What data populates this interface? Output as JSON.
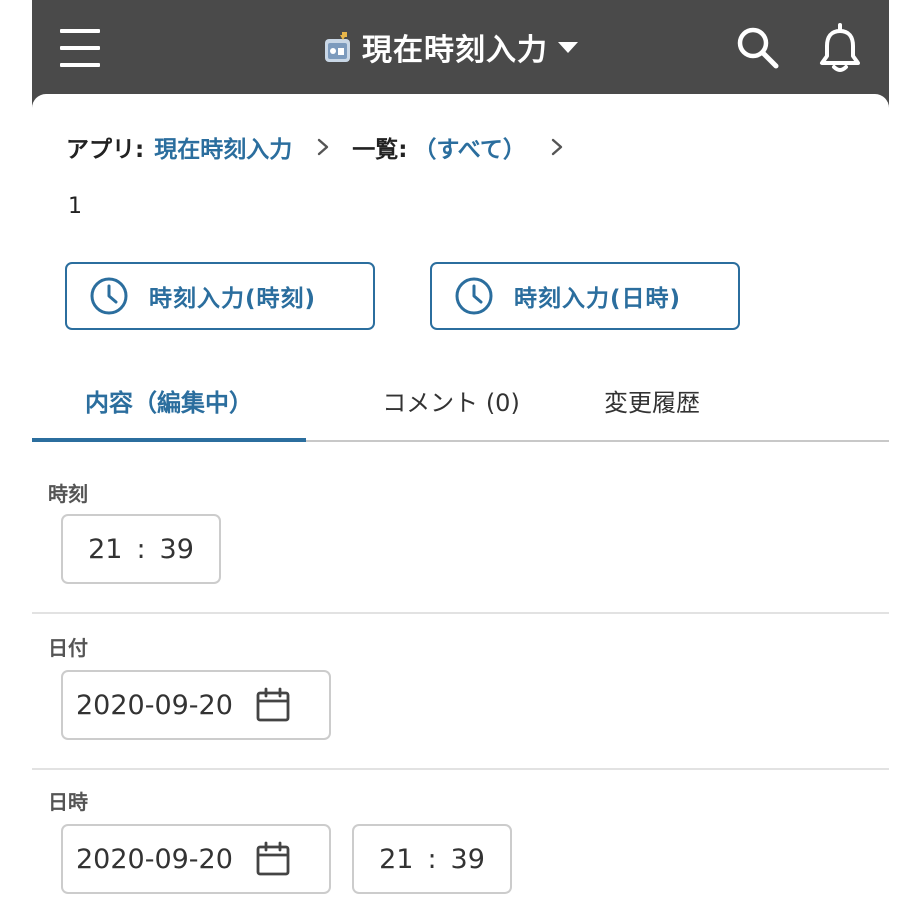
{
  "header": {
    "app_title": "現在時刻入力",
    "menu_icon": "hamburger-icon",
    "search_icon": "search-icon",
    "notification_icon": "bell-icon",
    "background_color": "#4a4a4a"
  },
  "breadcrumb": {
    "app_label": "アプリ:",
    "app_name": "現在時刻入力",
    "list_label": "一覧:",
    "list_name": "（すべて）"
  },
  "record": {
    "id": "1"
  },
  "actions": {
    "time_button_label": "時刻入力(時刻)",
    "datetime_button_label": "時刻入力(日時)",
    "accent_color": "#2b6e9e"
  },
  "tabs": [
    {
      "label": "内容（編集中）",
      "active": true
    },
    {
      "label": "コメント (0)",
      "active": false
    },
    {
      "label": "変更履歴",
      "active": false
    }
  ],
  "fields": {
    "time": {
      "label": "時刻",
      "hour": "21",
      "separator": ":",
      "minute": "39"
    },
    "date": {
      "label": "日付",
      "value": "2020-09-20"
    },
    "datetime": {
      "label": "日時",
      "date": "2020-09-20",
      "hour": "21",
      "separator": ":",
      "minute": "39"
    }
  }
}
